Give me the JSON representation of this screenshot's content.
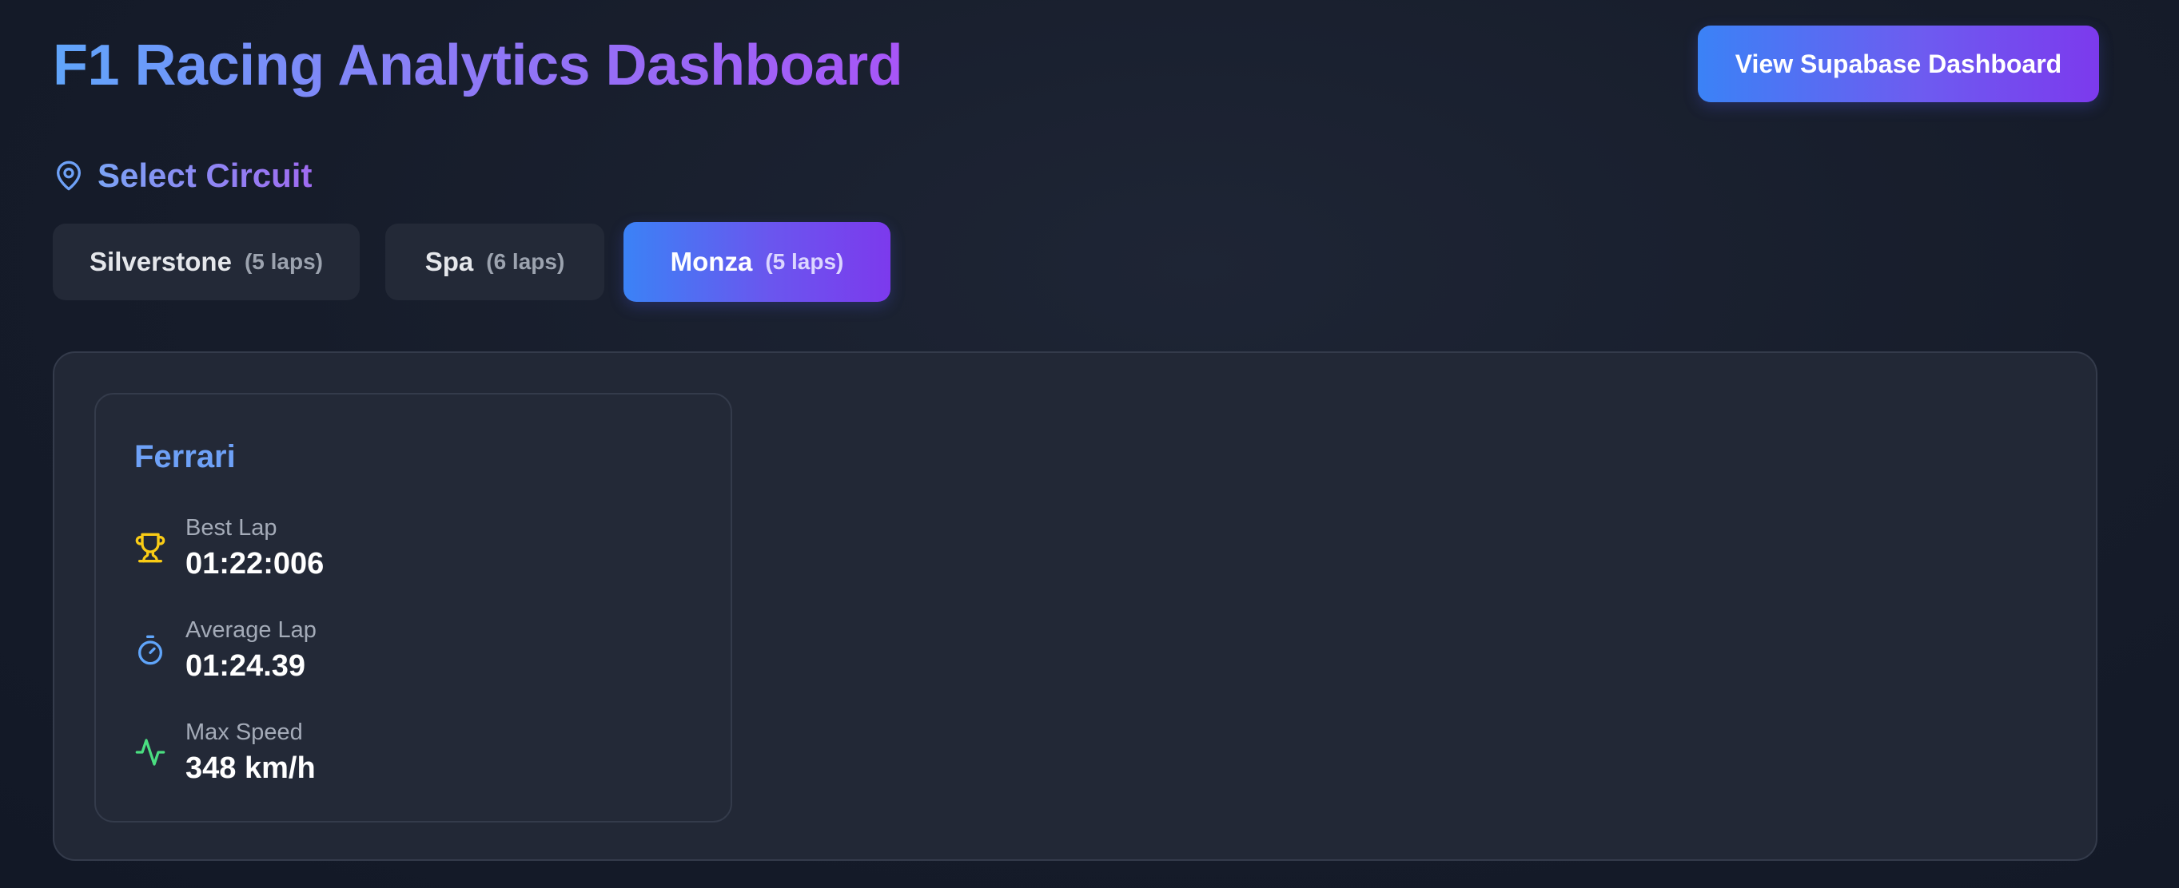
{
  "header": {
    "title": "F1 Racing Analytics Dashboard",
    "supabase_button_label": "View Supabase Dashboard"
  },
  "circuit_selector": {
    "heading": "Select Circuit",
    "icon": "map-pin-icon",
    "circuits": [
      {
        "name": "Silverstone",
        "laps": "(5 laps)",
        "selected": false
      },
      {
        "name": "Spa",
        "laps": "(6 laps)",
        "selected": false
      },
      {
        "name": "Monza",
        "laps": "(5 laps)",
        "selected": true
      }
    ]
  },
  "team_card": {
    "team_name": "Ferrari",
    "stats": [
      {
        "icon": "trophy-icon",
        "label": "Best Lap",
        "value": "01:22:006"
      },
      {
        "icon": "stopwatch-icon",
        "label": "Average Lap",
        "value": "01:24.39"
      },
      {
        "icon": "activity-icon",
        "label": "Max Speed",
        "value": "348 km/h"
      }
    ]
  },
  "colors": {
    "background": "#161c2a",
    "panel": "#222836",
    "accent_blue": "#3b82f6",
    "accent_purple": "#7c3aed",
    "team_name": "#6ea1f7",
    "trophy": "#facc15",
    "stopwatch": "#60a5fa",
    "activity": "#4ade80"
  }
}
